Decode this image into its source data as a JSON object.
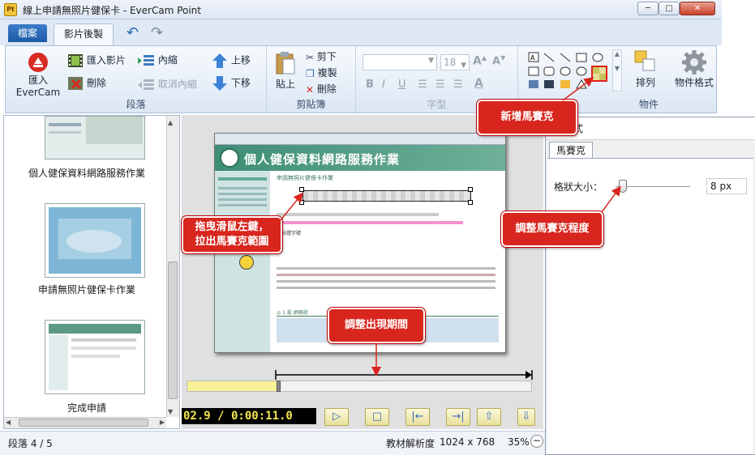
{
  "window": {
    "title": "線上申請無照片健保卡 - EverCam Point",
    "app_logo": "Pt",
    "controls": [
      "minimize-icon",
      "maximize-icon",
      "close-icon"
    ],
    "minimize": "─",
    "maximize": "□",
    "close": "✕"
  },
  "ribbon": {
    "tabs": [
      "檔案",
      "影片後製"
    ],
    "active_tab": "影片後製",
    "quick_access": [
      "undo-icon",
      "redo-icon"
    ],
    "undo": "↶",
    "redo": "↷",
    "groups": {
      "paragraph": {
        "label": "段落",
        "evercam_line1": "匯入",
        "evercam_line2": "EverCam",
        "import_video": "匯入影片",
        "delete": "刪除",
        "indent": "內縮",
        "cancel_indent": "取消內縮",
        "move_up": "上移",
        "move_down": "下移"
      },
      "clipboard": {
        "label": "剪貼簿",
        "paste": "貼上",
        "cut": "剪下",
        "copy": "複製",
        "delete": "刪除"
      },
      "font": {
        "label": "字型",
        "font_size": "18",
        "bold": "B",
        "italic": "I",
        "underline": "U"
      },
      "objects": {
        "label": "物件",
        "arrange": "排列",
        "object_format": "物件格式"
      }
    }
  },
  "left_panel": {
    "items": [
      {
        "label": "個人健保資料網路服務作業"
      },
      {
        "label": "申請無照片健保卡作業"
      },
      {
        "label": "完成申請"
      }
    ]
  },
  "slide": {
    "heading": "個人健保資料網路服務作業",
    "subheading": "申請無照片健保卡作業",
    "field_label": "身份證字號",
    "section_title": "◎ 1.投 網務說"
  },
  "player": {
    "timecode": "02.9 / 0:00:11.0",
    "buttons": [
      "play-icon",
      "stop-icon",
      "go-start-icon",
      "go-end-icon",
      "move-up-icon",
      "move-down-icon"
    ]
  },
  "dialog": {
    "title_partial": "式",
    "tab": "馬賽克",
    "shape_size_label": "格狀大小：",
    "shape_size_value": "8 px",
    "shape_size_slider_fraction": 0.1
  },
  "callouts": {
    "add_mosaic": "新增馬賽克",
    "drag_mouse_line1": "拖曳滑鼠左鍵，",
    "drag_mouse_line2": "拉出馬賽克範圍",
    "adjust_mosaic": "調整馬賽克程度",
    "adjust_period": "調整出現期間"
  },
  "statusbar": {
    "segment": "段落 4 / 5",
    "resolution_label": "教材解析度",
    "resolution_value": "1024 x 768",
    "zoom": "35%"
  },
  "colors": {
    "callout": "#d8251d",
    "timecode_text": "#f2e64e",
    "ribbon_blue": "#2d67b3"
  }
}
